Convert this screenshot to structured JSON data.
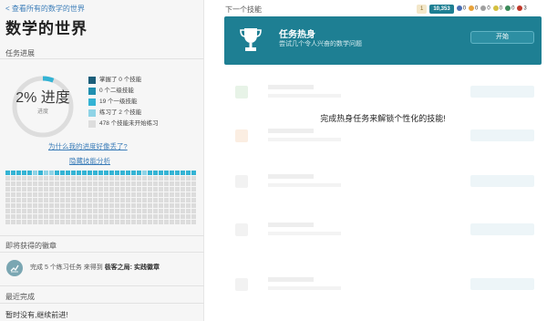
{
  "back_link": "< 查看所有的数学的世界",
  "page_title": "数学的世界",
  "progress_section": {
    "label": "任务进展",
    "percent_text": "2% 进度",
    "sub_text": "进度",
    "percent_value": 2,
    "legend": [
      {
        "label": "掌握了 0 个技能",
        "color": "#1b5e7a"
      },
      {
        "label": "0 个二级技能",
        "color": "#1f8fb0"
      },
      {
        "label": "19 个一级技能",
        "color": "#34b3d4"
      },
      {
        "label": "练习了 2 个技能",
        "color": "#8fd3e6"
      },
      {
        "label": "478 个技能未开始练习",
        "color": "#dddddd"
      }
    ],
    "why_link": "为什么我的进度好像丢了?",
    "hide_analysis_link": "隐藏技能分析"
  },
  "badge_section": {
    "label": "即将获得的徽章",
    "text_prefix": "完成 5 个练习任务 来得到",
    "badge_name": "极客之局: 实践徽章"
  },
  "recent_section": {
    "label": "最近完成",
    "empty_text": "暂时没有,继续前进!"
  },
  "main": {
    "next_label": "下一个技能",
    "stats": {
      "points_small": "1",
      "points": "10,353",
      "badges": [
        {
          "count": "0",
          "color": "#4a6fb5"
        },
        {
          "count": "0",
          "color": "#e8a23a"
        },
        {
          "count": "0",
          "color": "#a0a0a0"
        },
        {
          "count": "0",
          "color": "#d4c040"
        },
        {
          "count": "0",
          "color": "#3c8b5a"
        },
        {
          "count": "3",
          "color": "#c0392b"
        }
      ]
    },
    "warmup": {
      "title": "任务热身",
      "subtitle": "尝试几个令人兴奋的数学问题",
      "button": "开始"
    },
    "locked_message": "完成热身任务来解锁个性化的技能!"
  },
  "colors": {
    "accent": "#1e7f93",
    "link": "#3a7cb8"
  }
}
